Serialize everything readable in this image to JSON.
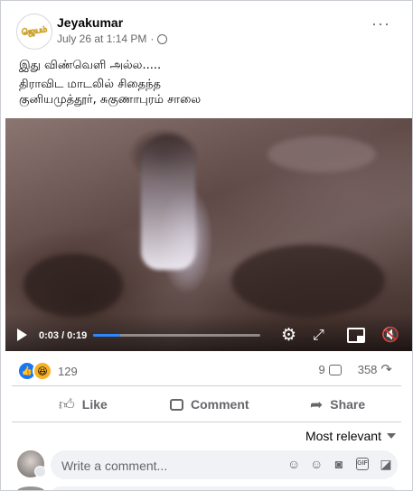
{
  "post": {
    "author": "Jeyakumar",
    "timestamp": "July 26 at 1:14 PM",
    "separator": "·",
    "privacy_icon": "globe-icon",
    "logo_text": "ஜெயம்",
    "more_label": "···",
    "text_lines": [
      "இது விண்வெளி அல்ல.....",
      "திராவிட மாடலில் சிதைந்த",
      "குனியமுத்தூர், சுகுணாபுரம் சாலை"
    ]
  },
  "video": {
    "time": "0:03 / 0:19",
    "progress": 0.16,
    "progress_color": "#2d88ff",
    "play_icon": "play-icon",
    "settings_icon": "gear-icon",
    "fullscreen_icon": "expand-icon",
    "pip_icon": "picture-in-picture-icon",
    "mute_icon": "volume-muted-icon"
  },
  "engagement": {
    "reaction_count": "129",
    "comment_count": "9",
    "share_count": "358"
  },
  "actions": {
    "like": "Like",
    "comment": "Comment",
    "share": "Share"
  },
  "comments": {
    "sort_label": "Most relevant",
    "placeholder": "Write a comment..."
  },
  "colors": {
    "accent": "#1877f2",
    "text_secondary": "#65676b",
    "haha": "#f7b125"
  }
}
